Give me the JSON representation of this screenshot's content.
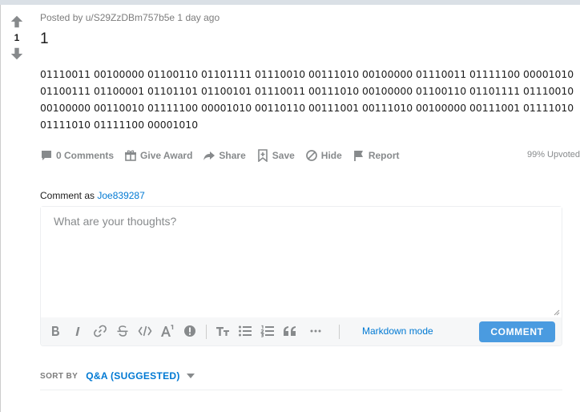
{
  "post": {
    "meta": "Posted by u/S29ZzDBm757b5e 1 day ago",
    "vote_count": "1",
    "title": "1",
    "body": "01110011 00100000 01100110 01101111 01110010 00111010 00100000 01110011 01111100 00001010\n01100111 01100001 01101101 01100101 01110011 00111010 00100000 01100110 01101111 01110010\n00100000 00110010 01111100 00001010 00110110 00111001 00111010 00100000 00111001 01111010\n01111010 01111100 00001010",
    "upvoted": "99% Upvoted"
  },
  "actions": {
    "comments": "0 Comments",
    "award": "Give Award",
    "share": "Share",
    "save": "Save",
    "hide": "Hide",
    "report": "Report"
  },
  "composer": {
    "comment_as_prefix": "Comment as",
    "username": "Joe839287",
    "placeholder": "What are your thoughts?",
    "markdown_mode": "Markdown mode",
    "submit_label": "COMMENT"
  },
  "sort": {
    "label": "SORT BY",
    "value": "Q&A (SUGGESTED)"
  },
  "icons": {
    "upvote": "arrow-up-icon",
    "downvote": "arrow-down-icon",
    "comments": "comment-bubble-icon",
    "award": "gift-icon",
    "share": "share-arrow-icon",
    "save": "bookmark-plus-icon",
    "hide": "circle-slash-icon",
    "report": "flag-icon"
  },
  "colors": {
    "link": "#0079d3",
    "button": "#4a9be0",
    "muted": "#878a8c"
  }
}
